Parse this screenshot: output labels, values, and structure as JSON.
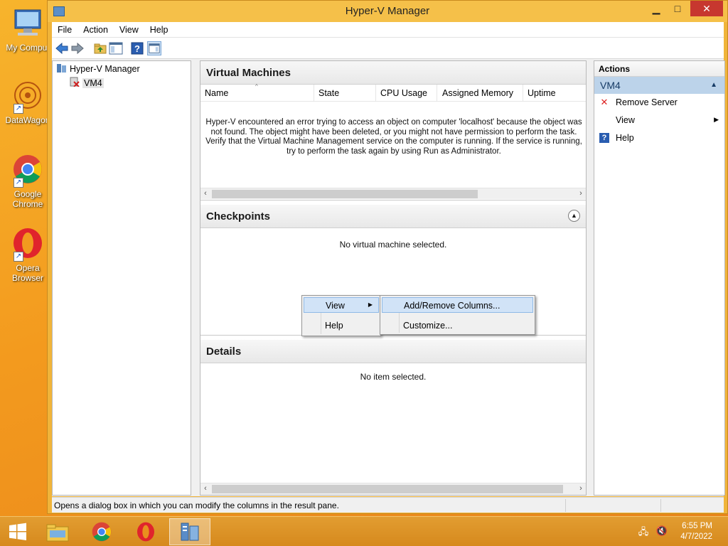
{
  "desktop": {
    "icons": [
      {
        "label": "My Comput",
        "icon": "computer-icon"
      },
      {
        "label": "DataWagon",
        "icon": "datawagon-icon"
      },
      {
        "label": "Google Chrome",
        "icon": "chrome-icon"
      },
      {
        "label": "Opera Browser",
        "icon": "opera-icon"
      }
    ]
  },
  "window": {
    "title": "Hyper-V Manager",
    "controls": {
      "minimize": "▁",
      "maximize": "□",
      "close": "✕"
    }
  },
  "menubar": {
    "items": [
      "File",
      "Action",
      "View",
      "Help"
    ]
  },
  "toolbar": {
    "buttons": [
      "back-icon",
      "forward-icon",
      "up-folder-icon",
      "show-hide-console-tree-icon",
      "help-icon",
      "show-hide-action-pane-icon"
    ]
  },
  "tree": {
    "root": "Hyper-V Manager",
    "child": "VM4"
  },
  "virtual_machines": {
    "title": "Virtual Machines",
    "columns": [
      "Name",
      "State",
      "CPU Usage",
      "Assigned Memory",
      "Uptime"
    ],
    "error_message": "Hyper-V encountered an error trying to access an object on computer 'localhost' because the object was not found. The object might have been deleted, or you might not have permission to perform the task. Verify that the Virtual Machine Management service on the computer is running. If the service is running, try to perform the task again by using Run as Administrator."
  },
  "checkpoints": {
    "title": "Checkpoints",
    "empty_message": "No virtual machine selected."
  },
  "details": {
    "title": "Details",
    "empty_message": "No item selected."
  },
  "actions_pane": {
    "header": "Actions",
    "group": "VM4",
    "items": [
      {
        "label": "Remove Server",
        "icon": "remove-x-icon"
      },
      {
        "label": "View",
        "icon": "",
        "has_submenu": true
      },
      {
        "label": "Help",
        "icon": "help-icon"
      }
    ]
  },
  "context_menu": {
    "items": [
      "View",
      "Help"
    ],
    "submenu": [
      "Add/Remove Columns...",
      "Customize..."
    ]
  },
  "statusbar": {
    "text": "Opens a dialog box in which you can modify the columns in the result pane."
  },
  "taskbar": {
    "apps": [
      "file-explorer-icon",
      "chrome-icon",
      "opera-icon",
      "hyper-v-manager-icon"
    ],
    "time": "6:55 PM",
    "date": "4/7/2022"
  }
}
